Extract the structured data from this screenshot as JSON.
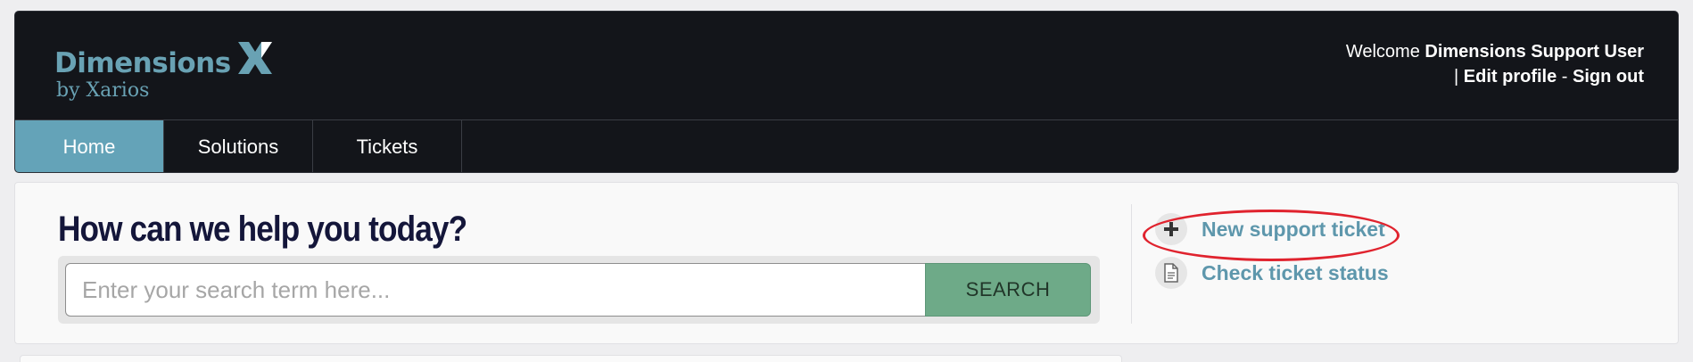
{
  "logo": {
    "name": "Dimensions",
    "sub": "by Xarios",
    "accent": "#69a2b4"
  },
  "user": {
    "welcome": "Welcome",
    "name": "Dimensions Support User",
    "separator": "|",
    "edit_profile": "Edit profile",
    "dash": "-",
    "sign_out": "Sign out"
  },
  "nav": {
    "items": [
      {
        "label": "Home",
        "active": true
      },
      {
        "label": "Solutions",
        "active": false
      },
      {
        "label": "Tickets",
        "active": false
      }
    ],
    "active_color": "#64a3b8"
  },
  "help": {
    "title": "How can we help you today?",
    "search_placeholder": "Enter your search term here...",
    "search_value": "",
    "search_button": "SEARCH"
  },
  "actions": {
    "new_ticket": {
      "label": "New support ticket",
      "icon": "plus-icon"
    },
    "check_status": {
      "label": "Check ticket status",
      "icon": "document-icon"
    }
  },
  "annotation": {
    "color": "#e0232e"
  }
}
